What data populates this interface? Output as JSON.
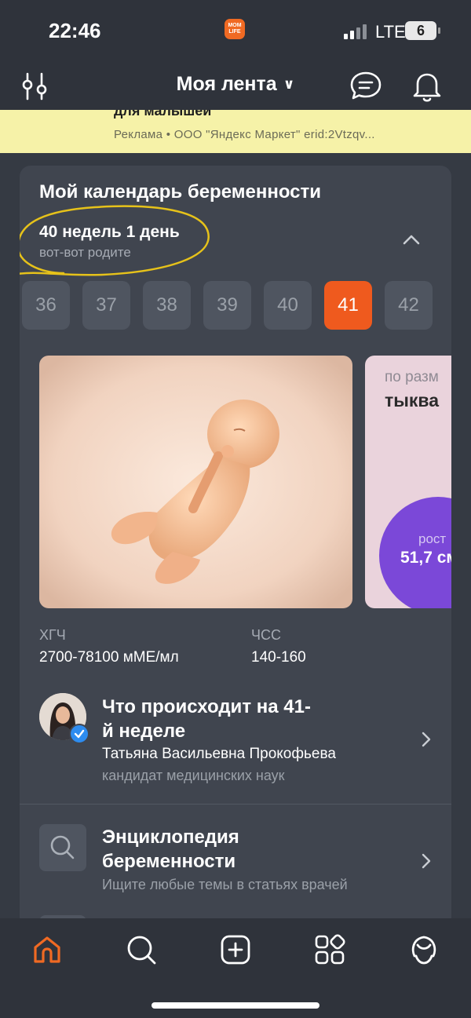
{
  "status_bar": {
    "time": "22:46",
    "app_badge": "MOM LIFE",
    "network": "LTE",
    "battery": "6"
  },
  "header": {
    "title": "Моя лента"
  },
  "ad": {
    "title": "для малышей",
    "meta": "Реклама  •  ООО \"Яндекс Маркет\" erid:2Vtzqv..."
  },
  "calendar": {
    "title": "Мой календарь беременности",
    "weeks_count": "40 недель 1 день",
    "status": "вот-вот родите",
    "weeks": [
      "36",
      "37",
      "38",
      "39",
      "40",
      "41",
      "42"
    ],
    "active_week": "41",
    "size": {
      "label": "по разм",
      "name": "тыква",
      "stat_label": "рост",
      "stat_value": "51,7 см"
    },
    "metrics": [
      {
        "label": "ХГЧ",
        "value": "2700-78100 мМЕ/мл"
      },
      {
        "label": "ЧСС",
        "value": "140-160"
      }
    ]
  },
  "article": {
    "title_line1": "Что происходит на 41-",
    "title_line2": "й неделе",
    "author": "Татьяна Васильевна Прокофьева",
    "author_title": "кандидат медицинских наук"
  },
  "encyclopedia": {
    "title_line1": "Энциклопедия",
    "title_line2": "беременности",
    "subtitle": "Ищите любые темы в статьях врачей"
  },
  "bottom_nav": [
    "home-icon",
    "search-icon",
    "add-icon",
    "services-icon",
    "profile-icon"
  ],
  "colors": {
    "accent": "#ef5a1e",
    "card": "#40454f",
    "background": "#353a43",
    "purple": "#7b48d8"
  }
}
